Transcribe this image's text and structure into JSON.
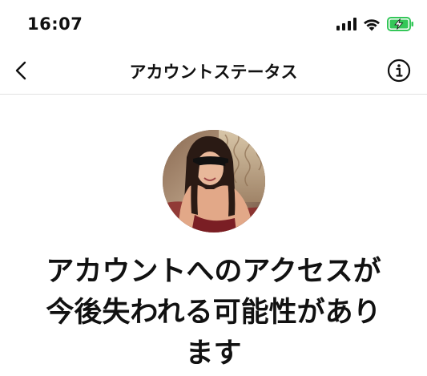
{
  "status_bar": {
    "time": "16:07",
    "signal_icon": "cellular-signal-icon",
    "wifi_icon": "wifi-icon",
    "battery_icon": "battery-charging-icon",
    "battery_color": "#34c759"
  },
  "nav": {
    "title": "アカウントステータス",
    "back_icon": "chevron-left-icon",
    "info_icon": "info-circle-icon"
  },
  "profile": {
    "avatar_icon": "profile-photo"
  },
  "headline": {
    "lines": [
      "アカウントへのアクセスが",
      "今後失われる可能性があり",
      "ます"
    ]
  }
}
